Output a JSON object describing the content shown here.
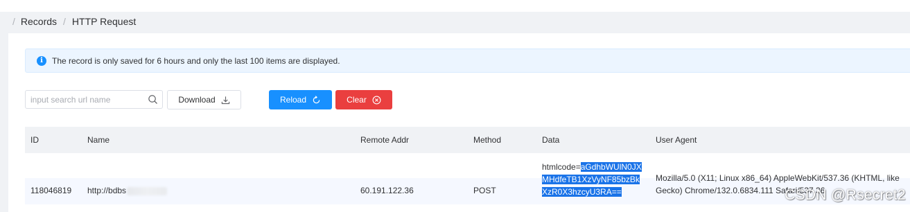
{
  "breadcrumb": {
    "items": [
      "Records",
      "HTTP Request"
    ]
  },
  "alert": {
    "text": "The record is only saved for 6 hours and only the last 100 items are displayed.",
    "icon": "info-circle-icon"
  },
  "toolbar": {
    "search_placeholder": "input search url name",
    "search_value": "",
    "download_label": "Download",
    "reload_label": "Reload",
    "clear_label": "Clear"
  },
  "table": {
    "columns": [
      "ID",
      "Name",
      "Remote Addr",
      "Method",
      "Data",
      "User Agent"
    ],
    "rows": [
      {
        "id": "118046819",
        "name": "http://bdbs",
        "remote_addr": "60.191.122.36",
        "method": "POST",
        "data_prefix": "htmlcode=",
        "data_selected_1": "aGdhbWUlN0JX",
        "data_selected_2": "MHdfeTB1XzVyNF85bzBk",
        "data_selected_3": "XzR0X3hzcyU3RA==",
        "user_agent_1": "Mozilla/5.0 (X11; Linux x86_64) AppleWebKit/537.36 (KHTML, like",
        "user_agent_2": "Gecko) Chrome/132.0.6834.111 Safari/537.36"
      }
    ]
  },
  "watermark": "CSDN @Rsecret2",
  "colors": {
    "primary": "#1890ff",
    "danger": "#ea3f3f",
    "alert_bg": "#ecf5ff",
    "header_bg": "#f0f2f5",
    "selection": "#1a73e8"
  }
}
